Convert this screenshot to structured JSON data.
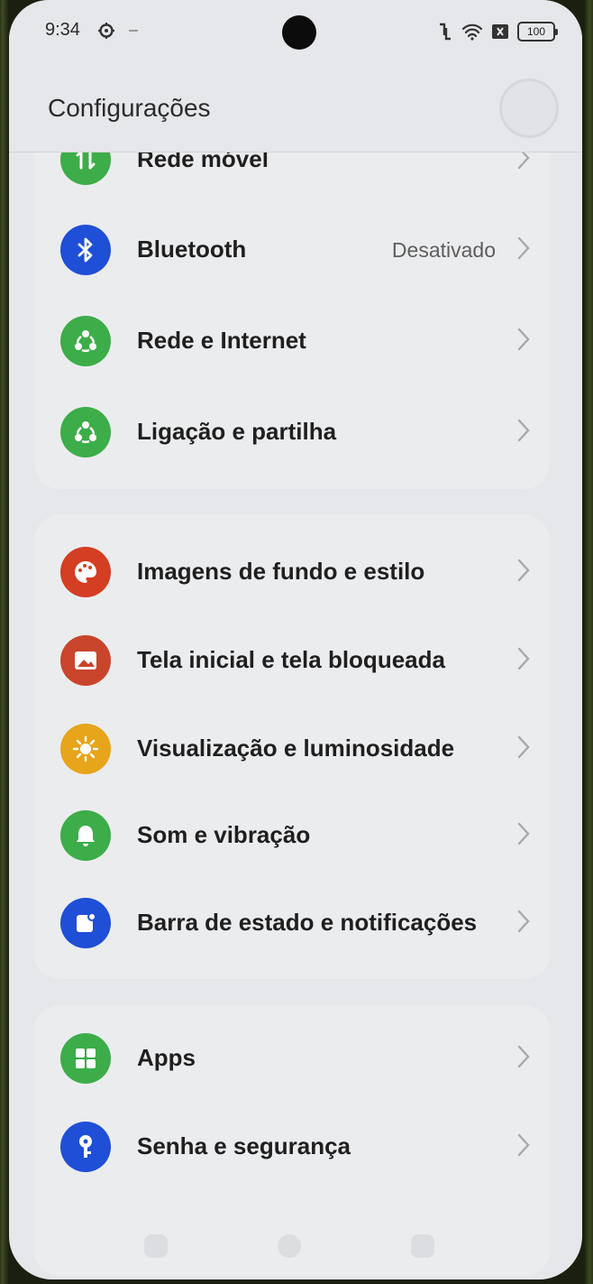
{
  "status_bar": {
    "time": "9:34",
    "battery": "100",
    "icons": [
      "settings-gear-icon",
      "nfc-icon",
      "wifi-icon",
      "sim-off-icon",
      "battery-icon"
    ]
  },
  "header": {
    "title": "Configurações"
  },
  "groups": [
    {
      "items": [
        {
          "label": "Rede móvel",
          "icon": "mobile-network-icon",
          "color": "#3cad49"
        },
        {
          "label": "Bluetooth",
          "value": "Desativado",
          "icon": "bluetooth-icon",
          "color": "#1f4fd6"
        },
        {
          "label": "Rede e Internet",
          "icon": "network-icon",
          "color": "#3cad49"
        },
        {
          "label": "Ligação e partilha",
          "icon": "share-icon",
          "color": "#3cad49"
        }
      ]
    },
    {
      "items": [
        {
          "label": "Imagens de fundo e estilo",
          "icon": "palette-icon",
          "color": "#d43e22"
        },
        {
          "label": "Tela inicial e tela bloqueada",
          "icon": "image-icon",
          "color": "#c8452b"
        },
        {
          "label": "Visualização e luminosidade",
          "icon": "brightness-icon",
          "color": "#e6a51a"
        },
        {
          "label": "Som e vibração",
          "icon": "bell-icon",
          "color": "#3cad49"
        },
        {
          "label": "Barra de estado e notificações",
          "icon": "notification-icon",
          "color": "#1f4fd6"
        }
      ]
    },
    {
      "items": [
        {
          "label": "Apps",
          "icon": "apps-grid-icon",
          "color": "#3cad49"
        },
        {
          "label": "Senha e segurança",
          "icon": "key-icon",
          "color": "#1f4fd6"
        }
      ]
    }
  ]
}
